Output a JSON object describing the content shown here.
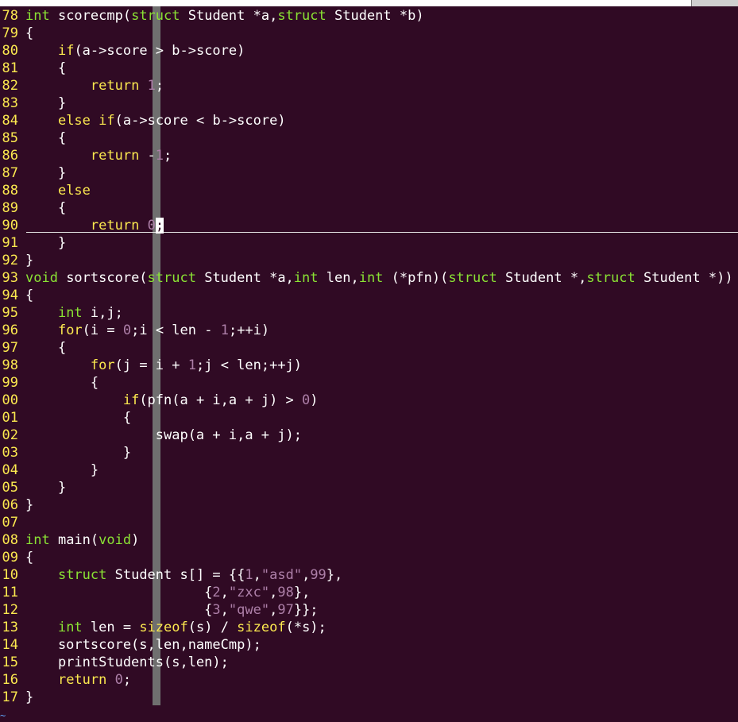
{
  "editor": {
    "lines": [
      {
        "num": "78",
        "tokens": [
          {
            "t": "ty",
            "v": "int"
          },
          {
            "t": "",
            "v": " scorecmp("
          },
          {
            "t": "ty",
            "v": "struct"
          },
          {
            "t": "",
            "v": " Student *a,"
          },
          {
            "t": "ty",
            "v": "struct"
          },
          {
            "t": "",
            "v": " Student *b)"
          }
        ]
      },
      {
        "num": "79",
        "tokens": [
          {
            "t": "",
            "v": "{"
          }
        ]
      },
      {
        "num": "80",
        "tokens": [
          {
            "t": "",
            "v": "    "
          },
          {
            "t": "kw",
            "v": "if"
          },
          {
            "t": "",
            "v": "(a->score > b->score)"
          }
        ]
      },
      {
        "num": "81",
        "tokens": [
          {
            "t": "",
            "v": "    {"
          }
        ]
      },
      {
        "num": "82",
        "tokens": [
          {
            "t": "",
            "v": "        "
          },
          {
            "t": "kw",
            "v": "return"
          },
          {
            "t": "",
            "v": " "
          },
          {
            "t": "num",
            "v": "1"
          },
          {
            "t": "",
            "v": ";"
          }
        ]
      },
      {
        "num": "83",
        "tokens": [
          {
            "t": "",
            "v": "    }"
          }
        ]
      },
      {
        "num": "84",
        "tokens": [
          {
            "t": "",
            "v": "    "
          },
          {
            "t": "kw",
            "v": "else"
          },
          {
            "t": "",
            "v": " "
          },
          {
            "t": "kw",
            "v": "if"
          },
          {
            "t": "",
            "v": "(a->score < b->score)"
          }
        ]
      },
      {
        "num": "85",
        "tokens": [
          {
            "t": "",
            "v": "    {"
          }
        ]
      },
      {
        "num": "86",
        "tokens": [
          {
            "t": "",
            "v": "        "
          },
          {
            "t": "kw",
            "v": "return"
          },
          {
            "t": "",
            "v": " -"
          },
          {
            "t": "num",
            "v": "1"
          },
          {
            "t": "",
            "v": ";"
          }
        ]
      },
      {
        "num": "87",
        "tokens": [
          {
            "t": "",
            "v": "    }"
          }
        ]
      },
      {
        "num": "88",
        "tokens": [
          {
            "t": "",
            "v": "    "
          },
          {
            "t": "kw",
            "v": "else"
          }
        ]
      },
      {
        "num": "89",
        "tokens": [
          {
            "t": "",
            "v": "    {"
          }
        ]
      },
      {
        "num": "90",
        "tokens": [
          {
            "t": "",
            "v": "        "
          },
          {
            "t": "kw",
            "v": "return"
          },
          {
            "t": "",
            "v": " "
          },
          {
            "t": "num",
            "v": "0"
          },
          {
            "t": "cursor",
            "v": ";"
          }
        ]
      },
      {
        "num": "91",
        "tokens": [
          {
            "t": "",
            "v": "    }"
          }
        ]
      },
      {
        "num": "92",
        "tokens": [
          {
            "t": "",
            "v": "}"
          }
        ]
      },
      {
        "num": "93",
        "tokens": [
          {
            "t": "ty",
            "v": "void"
          },
          {
            "t": "",
            "v": " sortscore("
          },
          {
            "t": "ty",
            "v": "struct"
          },
          {
            "t": "",
            "v": " Student *a,"
          },
          {
            "t": "ty",
            "v": "int"
          },
          {
            "t": "",
            "v": " len,"
          },
          {
            "t": "ty",
            "v": "int"
          },
          {
            "t": "",
            "v": " (*pfn)("
          },
          {
            "t": "ty",
            "v": "struct"
          },
          {
            "t": "",
            "v": " Student *,"
          },
          {
            "t": "ty",
            "v": "struct"
          },
          {
            "t": "",
            "v": " Student *))"
          }
        ]
      },
      {
        "num": "94",
        "tokens": [
          {
            "t": "",
            "v": "{"
          }
        ]
      },
      {
        "num": "95",
        "tokens": [
          {
            "t": "",
            "v": "    "
          },
          {
            "t": "ty",
            "v": "int"
          },
          {
            "t": "",
            "v": " i,j;"
          }
        ]
      },
      {
        "num": "96",
        "tokens": [
          {
            "t": "",
            "v": "    "
          },
          {
            "t": "kw",
            "v": "for"
          },
          {
            "t": "",
            "v": "(i = "
          },
          {
            "t": "num",
            "v": "0"
          },
          {
            "t": "",
            "v": ";i < len - "
          },
          {
            "t": "num",
            "v": "1"
          },
          {
            "t": "",
            "v": ";++i)"
          }
        ]
      },
      {
        "num": "97",
        "tokens": [
          {
            "t": "",
            "v": "    {"
          }
        ]
      },
      {
        "num": "98",
        "tokens": [
          {
            "t": "",
            "v": "        "
          },
          {
            "t": "kw",
            "v": "for"
          },
          {
            "t": "",
            "v": "(j = i + "
          },
          {
            "t": "num",
            "v": "1"
          },
          {
            "t": "",
            "v": ";j < len;++j)"
          }
        ]
      },
      {
        "num": "99",
        "tokens": [
          {
            "t": "",
            "v": "        {"
          }
        ]
      },
      {
        "num": "00",
        "tokens": [
          {
            "t": "",
            "v": "            "
          },
          {
            "t": "kw",
            "v": "if"
          },
          {
            "t": "",
            "v": "(pfn(a + i,a + j) > "
          },
          {
            "t": "num",
            "v": "0"
          },
          {
            "t": "",
            "v": ")"
          }
        ]
      },
      {
        "num": "01",
        "tokens": [
          {
            "t": "",
            "v": "            {"
          }
        ]
      },
      {
        "num": "02",
        "tokens": [
          {
            "t": "",
            "v": "                swap(a + i,a + j);"
          }
        ]
      },
      {
        "num": "03",
        "tokens": [
          {
            "t": "",
            "v": "            }"
          }
        ]
      },
      {
        "num": "04",
        "tokens": [
          {
            "t": "",
            "v": "        }"
          }
        ]
      },
      {
        "num": "05",
        "tokens": [
          {
            "t": "",
            "v": "    }"
          }
        ]
      },
      {
        "num": "06",
        "tokens": [
          {
            "t": "",
            "v": "}"
          }
        ]
      },
      {
        "num": "07",
        "tokens": []
      },
      {
        "num": "08",
        "tokens": [
          {
            "t": "ty",
            "v": "int"
          },
          {
            "t": "",
            "v": " main("
          },
          {
            "t": "ty",
            "v": "void"
          },
          {
            "t": "",
            "v": ")"
          }
        ]
      },
      {
        "num": "09",
        "tokens": [
          {
            "t": "",
            "v": "{"
          }
        ]
      },
      {
        "num": "10",
        "tokens": [
          {
            "t": "",
            "v": "    "
          },
          {
            "t": "ty",
            "v": "struct"
          },
          {
            "t": "",
            "v": " Student s[] = {{"
          },
          {
            "t": "num",
            "v": "1"
          },
          {
            "t": "",
            "v": ","
          },
          {
            "t": "str",
            "v": "\"asd\""
          },
          {
            "t": "",
            "v": ","
          },
          {
            "t": "num",
            "v": "99"
          },
          {
            "t": "",
            "v": "},"
          }
        ]
      },
      {
        "num": "11",
        "tokens": [
          {
            "t": "",
            "v": "                      {"
          },
          {
            "t": "num",
            "v": "2"
          },
          {
            "t": "",
            "v": ","
          },
          {
            "t": "str",
            "v": "\"zxc\""
          },
          {
            "t": "",
            "v": ","
          },
          {
            "t": "num",
            "v": "98"
          },
          {
            "t": "",
            "v": "},"
          }
        ]
      },
      {
        "num": "12",
        "tokens": [
          {
            "t": "",
            "v": "                      {"
          },
          {
            "t": "num",
            "v": "3"
          },
          {
            "t": "",
            "v": ","
          },
          {
            "t": "str",
            "v": "\"qwe\""
          },
          {
            "t": "",
            "v": ","
          },
          {
            "t": "num",
            "v": "97"
          },
          {
            "t": "",
            "v": "}};"
          }
        ]
      },
      {
        "num": "13",
        "tokens": [
          {
            "t": "",
            "v": "    "
          },
          {
            "t": "ty",
            "v": "int"
          },
          {
            "t": "",
            "v": " len = "
          },
          {
            "t": "kw",
            "v": "sizeof"
          },
          {
            "t": "",
            "v": "(s) / "
          },
          {
            "t": "kw",
            "v": "sizeof"
          },
          {
            "t": "",
            "v": "(*s);"
          }
        ]
      },
      {
        "num": "14",
        "tokens": [
          {
            "t": "",
            "v": "    sortscore(s,len,nameCmp);"
          }
        ]
      },
      {
        "num": "15",
        "tokens": [
          {
            "t": "",
            "v": "    printStudents(s,len);"
          }
        ]
      },
      {
        "num": "16",
        "tokens": [
          {
            "t": "",
            "v": "    "
          },
          {
            "t": "kw",
            "v": "return"
          },
          {
            "t": "",
            "v": " "
          },
          {
            "t": "num",
            "v": "0"
          },
          {
            "t": "",
            "v": ";"
          }
        ]
      },
      {
        "num": "17",
        "tokens": [
          {
            "t": "",
            "v": "}"
          }
        ]
      }
    ],
    "eof_marker": "~"
  }
}
